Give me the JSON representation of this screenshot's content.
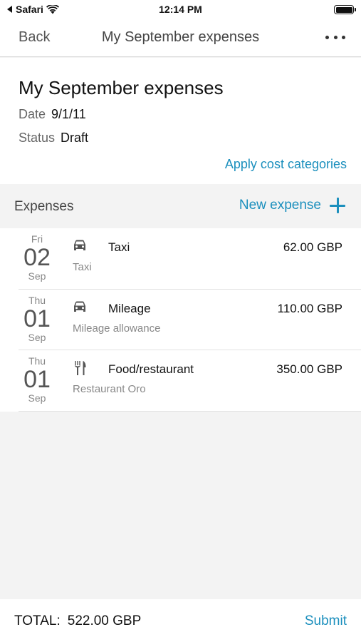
{
  "status_bar": {
    "back_app": "Safari",
    "time": "12:14 PM",
    "battery_level": 1.0
  },
  "nav": {
    "back_label": "Back",
    "title": "My September expenses",
    "more_icon": "more-horizontal-icon"
  },
  "report": {
    "title": "My September expenses",
    "date_label": "Date",
    "date_value": "9/1/11",
    "status_label": "Status",
    "status_value": "Draft",
    "apply_link": "Apply cost categories"
  },
  "expenses_section": {
    "title": "Expenses",
    "new_label": "New expense",
    "new_icon": "plus-icon"
  },
  "expenses": [
    {
      "dow": "Fri",
      "day": "02",
      "month": "Sep",
      "icon": "car-icon",
      "type": "Taxi",
      "description": "Taxi",
      "amount": "62.00 GBP"
    },
    {
      "dow": "Thu",
      "day": "01",
      "month": "Sep",
      "icon": "car-icon",
      "type": "Mileage",
      "description": "Mileage allowance",
      "amount": "110.00 GBP"
    },
    {
      "dow": "Thu",
      "day": "01",
      "month": "Sep",
      "icon": "fork-knife-icon",
      "type": "Food/restaurant",
      "description": "Restaurant Oro",
      "amount": "350.00 GBP"
    }
  ],
  "footer": {
    "total_label": "TOTAL:",
    "total_value": "522.00 GBP",
    "submit_label": "Submit"
  },
  "colors": {
    "accent": "#1b8fbd",
    "background": "#f3f3f3"
  }
}
